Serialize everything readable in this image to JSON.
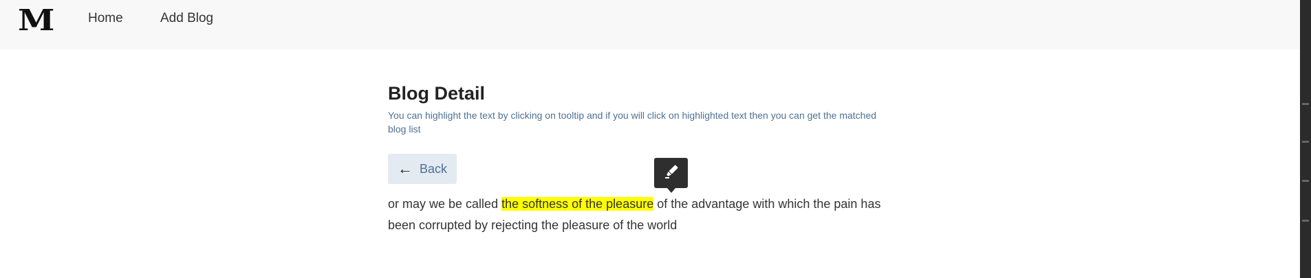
{
  "nav": {
    "logo": "M",
    "home_label": "Home",
    "add_blog_label": "Add Blog"
  },
  "page": {
    "title": "Blog Detail",
    "hint": "You can highlight the text by clicking on tooltip and if you will click on highlighted text then you can get the matched blog list",
    "back_label": "Back",
    "back_icon": "arrow-left-icon"
  },
  "blog": {
    "text_before": "or may we be called ",
    "highlighted": "the softness of the pleasure",
    "text_after": " of the advantage with which the pain has been corrupted by rejecting the pleasure of the world"
  },
  "tooltip": {
    "icon": "highlighter-icon"
  },
  "colors": {
    "highlight": "#ffff00",
    "accent": "#4d7193",
    "navbar_bg": "#f8f8f8",
    "tooltip_bg": "#2e2e2e",
    "back_btn_bg": "#e3eaf1"
  }
}
